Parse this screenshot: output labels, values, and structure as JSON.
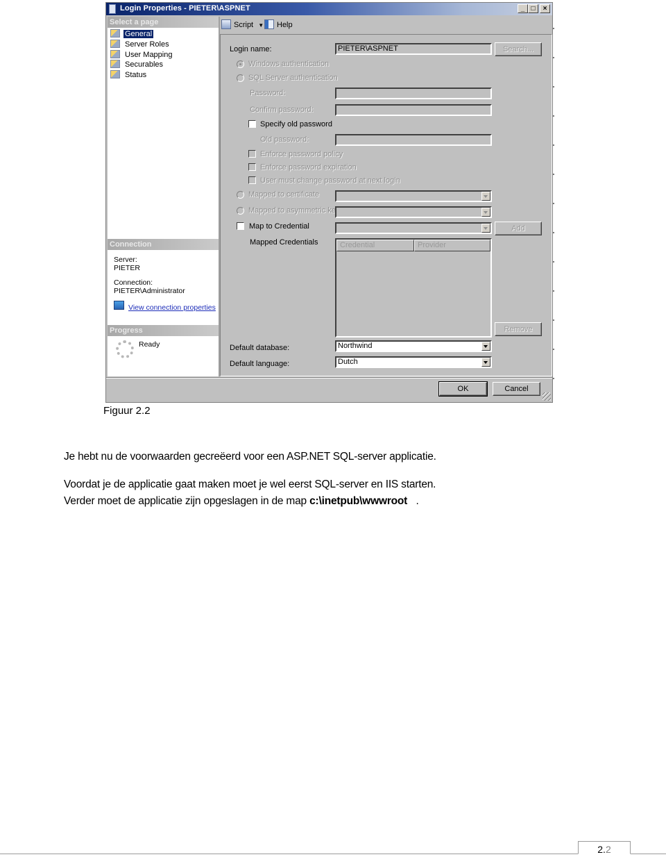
{
  "dialog": {
    "title": "Login Properties - PIETER\\ASPNET",
    "window_controls": {
      "minimize": "_",
      "maximize": "□",
      "close": "×"
    },
    "left_panel": {
      "select_page_header": "Select a page",
      "pages": [
        {
          "label": "General",
          "selected": true
        },
        {
          "label": "Server Roles",
          "selected": false
        },
        {
          "label": "User Mapping",
          "selected": false
        },
        {
          "label": "Securables",
          "selected": false
        },
        {
          "label": "Status",
          "selected": false
        }
      ],
      "connection_header": "Connection",
      "server_label": "Server:",
      "server_value": "PIETER",
      "connection_label": "Connection:",
      "connection_value": "PIETER\\Administrator",
      "view_connection_link": "View connection properties",
      "progress_header": "Progress",
      "progress_status": "Ready"
    },
    "toolbar": {
      "script_label": "Script",
      "help_label": "Help"
    },
    "general": {
      "login_name_label": "Login name:",
      "login_name_value": "PIETER\\ASPNET",
      "search_button": "Search...",
      "windows_auth_label": "Windows authentication",
      "windows_auth_selected": true,
      "sql_auth_label": "SQL Server authentication",
      "sql_auth_selected": false,
      "password_label": "Password:",
      "password_value": "",
      "confirm_password_label": "Confirm password:",
      "confirm_password_value": "",
      "specify_old_password_label": "Specify old password",
      "specify_old_password_checked": false,
      "old_password_label": "Old password:",
      "old_password_value": "",
      "enforce_policy_label": "Enforce password policy",
      "enforce_policy_checked": false,
      "enforce_expiration_label": "Enforce password expiration",
      "enforce_expiration_checked": false,
      "must_change_label": "User must change password at next login",
      "must_change_checked": false,
      "mapped_certificate_label": "Mapped to certificate",
      "mapped_certificate_value": "",
      "mapped_asym_key_label": "Mapped to asymmetric key",
      "mapped_asym_key_value": "",
      "map_credential_label": "Map to Credential",
      "map_credential_checked": false,
      "map_credential_value": "",
      "add_button": "Add",
      "mapped_credentials_label": "Mapped Credentials",
      "credentials_columns": [
        "Credential",
        "Provider"
      ],
      "credentials_rows": [],
      "remove_button": "Remove",
      "default_database_label": "Default database:",
      "default_database_value": "Northwind",
      "default_language_label": "Default language:",
      "default_language_value": "Dutch"
    },
    "footer": {
      "ok_button": "OK",
      "cancel_button": "Cancel"
    }
  },
  "document": {
    "caption": "Figuur 2.2",
    "paragraph1": "Je hebt nu de voorwaarden gecreëerd voor een ASP.NET SQL-server applicatie.",
    "paragraph2_line1": "Voordat je de applicatie gaat maken moet je wel eerst SQL-server en IIS starten.",
    "paragraph2_line2_prefix": "Verder moet de applicatie zijn opgeslagen in de map ",
    "paragraph2_line2_bold": "c:\\inetpub\\wwwroot",
    "paragraph2_line2_suffix": "   .",
    "page_number_main": "2.",
    "page_number_sub": "2"
  }
}
